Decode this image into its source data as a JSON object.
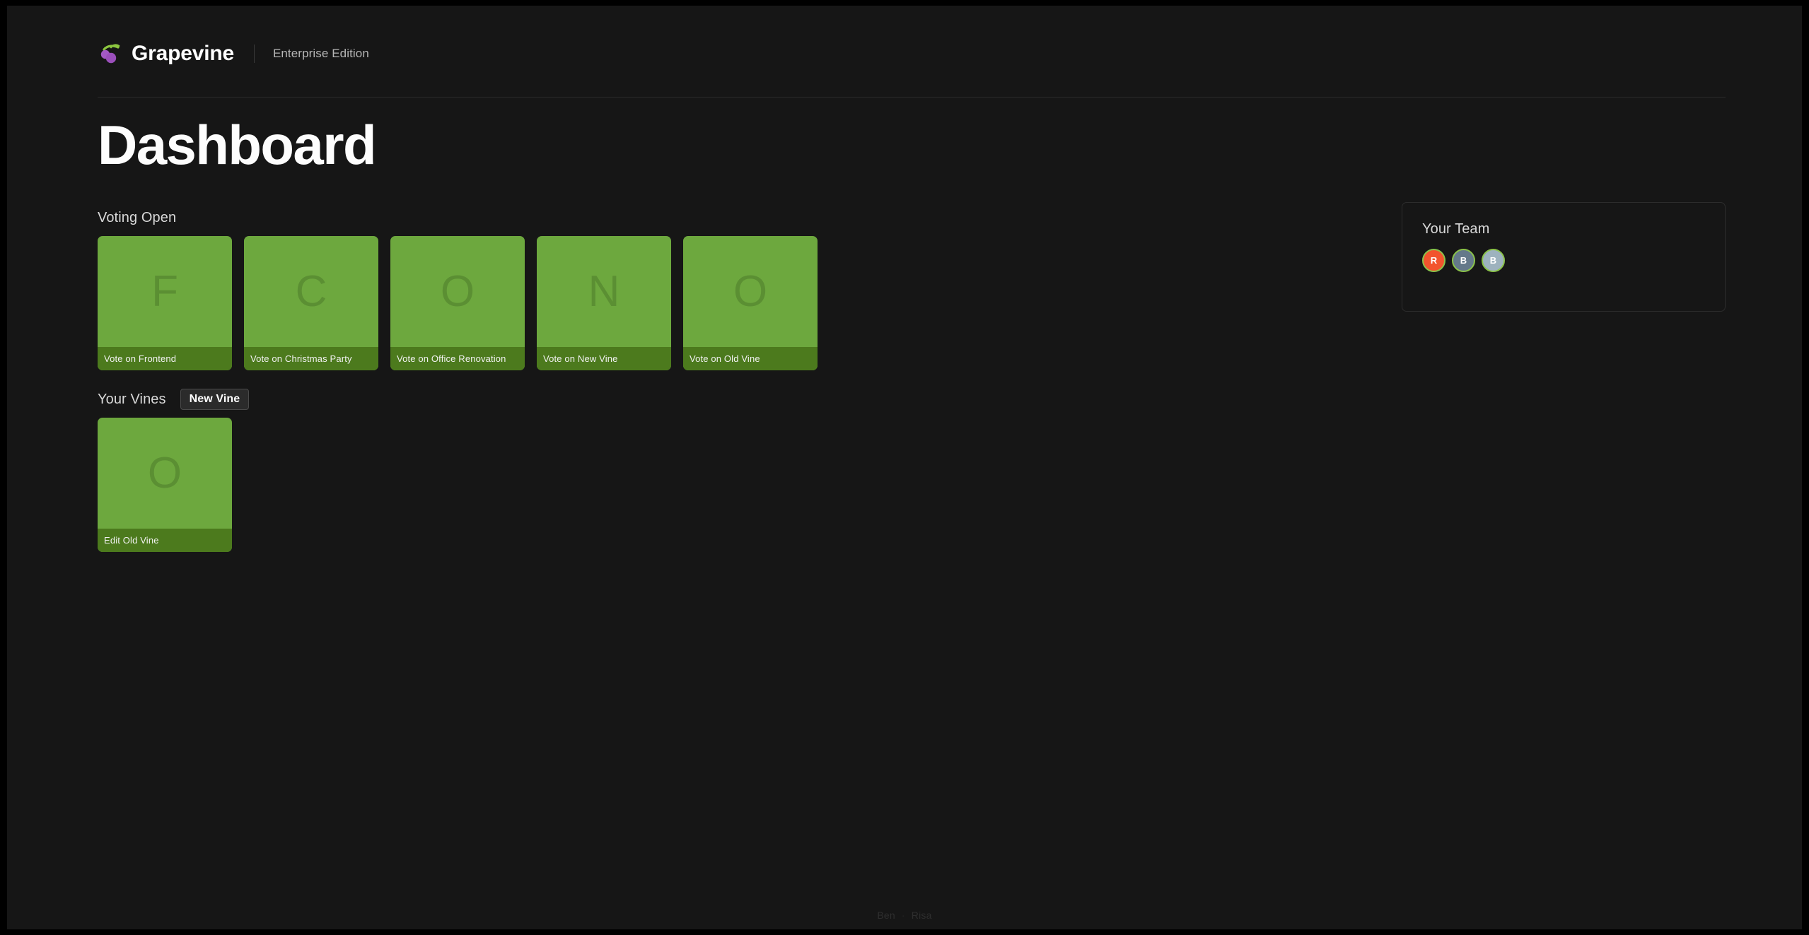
{
  "header": {
    "logo_icon": "grape-cluster-icon",
    "brand_name": "Grapevine",
    "edition_label": "Enterprise Edition"
  },
  "page": {
    "title": "Dashboard"
  },
  "voting_section": {
    "title": "Voting Open",
    "cards": [
      {
        "initial": "F",
        "action_label": "Vote on Frontend"
      },
      {
        "initial": "C",
        "action_label": "Vote on Christmas Party"
      },
      {
        "initial": "O",
        "action_label": "Vote on Office Renovation"
      },
      {
        "initial": "N",
        "action_label": "Vote on New Vine"
      },
      {
        "initial": "O",
        "action_label": "Vote on Old Vine"
      }
    ]
  },
  "vines_section": {
    "title": "Your Vines",
    "new_vine_label": "New Vine",
    "cards": [
      {
        "initial": "O",
        "action_label": "Edit Old Vine"
      }
    ]
  },
  "team_panel": {
    "title": "Your Team",
    "members": [
      {
        "initial": "R",
        "color": "#f2542d",
        "ring": "#8bc34a"
      },
      {
        "initial": "B",
        "color": "#64798a",
        "ring": "#8bc34a"
      },
      {
        "initial": "B",
        "color": "#9db2be",
        "ring": "#8bc34a"
      }
    ]
  },
  "footer": {
    "name_left": "Ben",
    "separator": "·",
    "name_right": "Risa"
  },
  "colors": {
    "page_background": "#161616",
    "frame": "#000000",
    "card_green": "#6da83e",
    "card_footer_green": "#4c7a1d",
    "card_initial_green": "#5b8f33",
    "accent_ring": "#8bc34a",
    "text_primary": "#fdfdfd",
    "text_secondary": "#d8d8d8"
  }
}
